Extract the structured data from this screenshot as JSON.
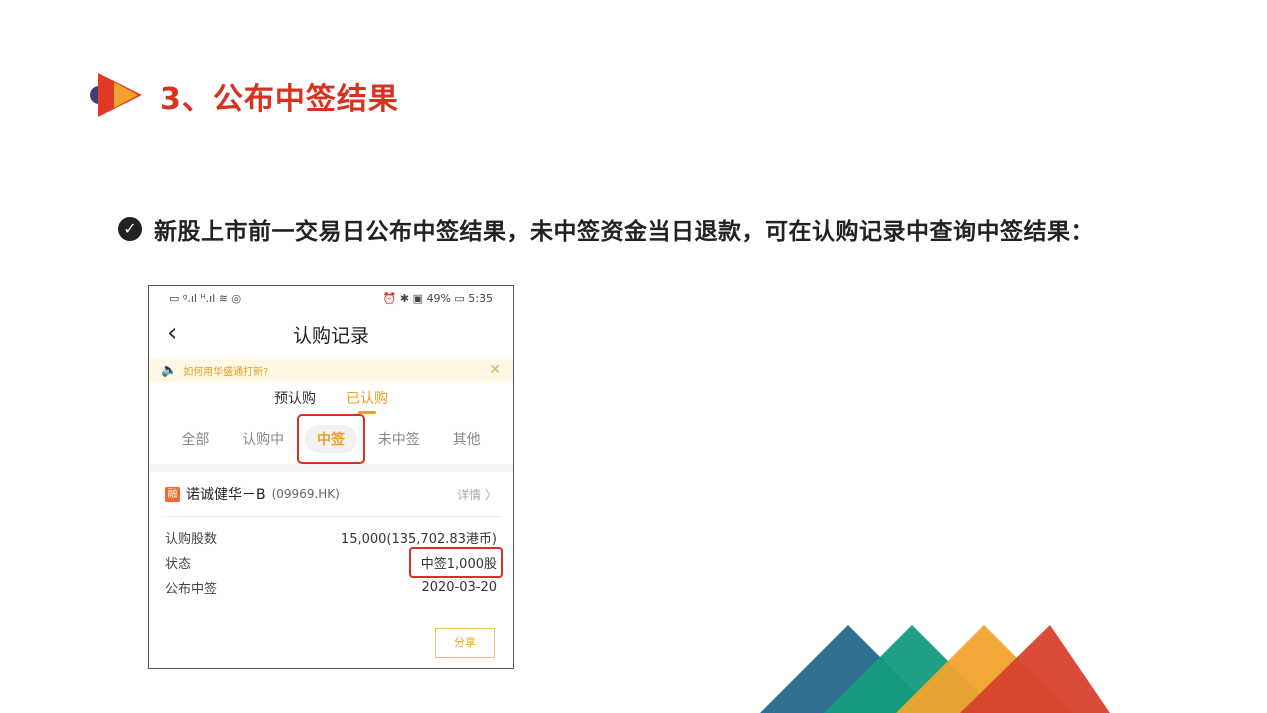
{
  "slide": {
    "title": "3、公布中签结果",
    "description": "新股上市前一交易日公布中签结果，未中签资金当日退款，可在认购记录中查询中签结果："
  },
  "phone": {
    "status_left": "▭ ᵍ.ıl ᴴ.ıl ≋ ◎",
    "status_right": "⏰ ✱ ▣ 49% ▭ 5:35",
    "nav_title": "认购记录",
    "notice": "如何用华盛通打新?",
    "subtabs": [
      {
        "label": "预认购",
        "active": false
      },
      {
        "label": "已认购",
        "active": true
      }
    ],
    "filter_tabs": [
      {
        "label": "全部",
        "active": false
      },
      {
        "label": "认购中",
        "active": false
      },
      {
        "label": "中签",
        "active": true
      },
      {
        "label": "未中签",
        "active": false
      },
      {
        "label": "其他",
        "active": false
      }
    ],
    "stock": {
      "badge": "融",
      "name": "诺诚健华－B",
      "code": "(09969.HK)",
      "detail": "详情 〉"
    },
    "info": [
      {
        "label": "认购股数",
        "value": "15,000(135,702.83港币)"
      },
      {
        "label": "状态",
        "value": "中签1,000股"
      },
      {
        "label": "公布中签",
        "value": "2020-03-20"
      }
    ],
    "share_label": "分享"
  },
  "colors": {
    "accent": "#f0a020",
    "highlight": "#d8321f",
    "triangles": [
      "#2f6f8f",
      "#159b7e",
      "#f0a32c",
      "#d8412e"
    ]
  }
}
